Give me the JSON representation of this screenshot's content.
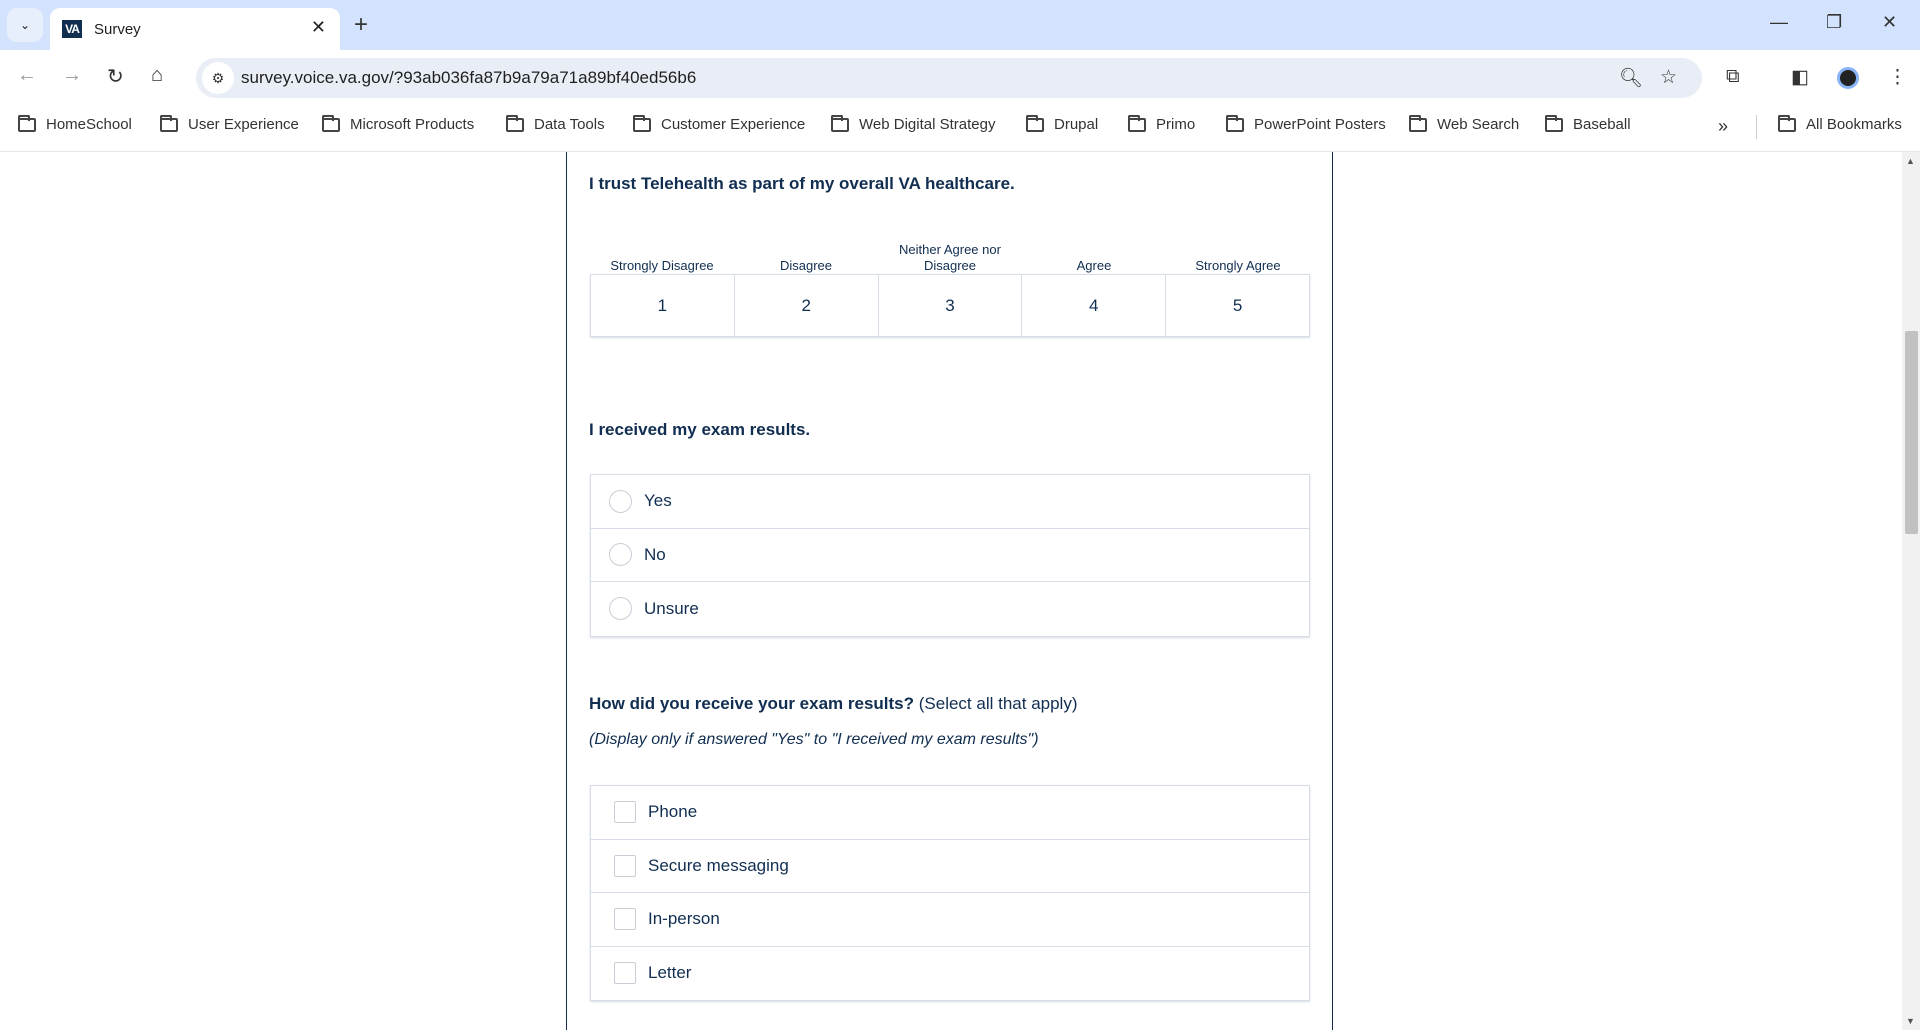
{
  "browser": {
    "tab_title": "Survey",
    "favicon_text": "VA",
    "url": "survey.voice.va.gov/?93ab036fa87b9a79a71a89bf40ed56b6",
    "bookmarks": [
      "HomeSchool",
      "User Experience",
      "Microsoft Products",
      "Data Tools",
      "Customer Experience",
      "Web Digital Strategy",
      "Drupal",
      "Primo",
      "PowerPoint Posters",
      "Web Search",
      "Baseball"
    ],
    "all_bookmarks": "All Bookmarks"
  },
  "survey": {
    "q1": {
      "text": "I trust Telehealth as part of my overall VA healthcare.",
      "labels": [
        "Strongly Disagree",
        "Disagree",
        "Neither Agree nor Disagree",
        "Agree",
        "Strongly Agree"
      ],
      "values": [
        "1",
        "2",
        "3",
        "4",
        "5"
      ]
    },
    "q2": {
      "text": "I received my exam results.",
      "options": [
        "Yes",
        "No",
        "Unsure"
      ]
    },
    "q3": {
      "text": "How did you receive your exam results?",
      "hint": "(Select all that apply)",
      "note": "(Display only if answered \"Yes\" to \"I received my exam results\")",
      "options": [
        "Phone",
        "Secure messaging",
        "In-person",
        "Letter"
      ]
    }
  }
}
